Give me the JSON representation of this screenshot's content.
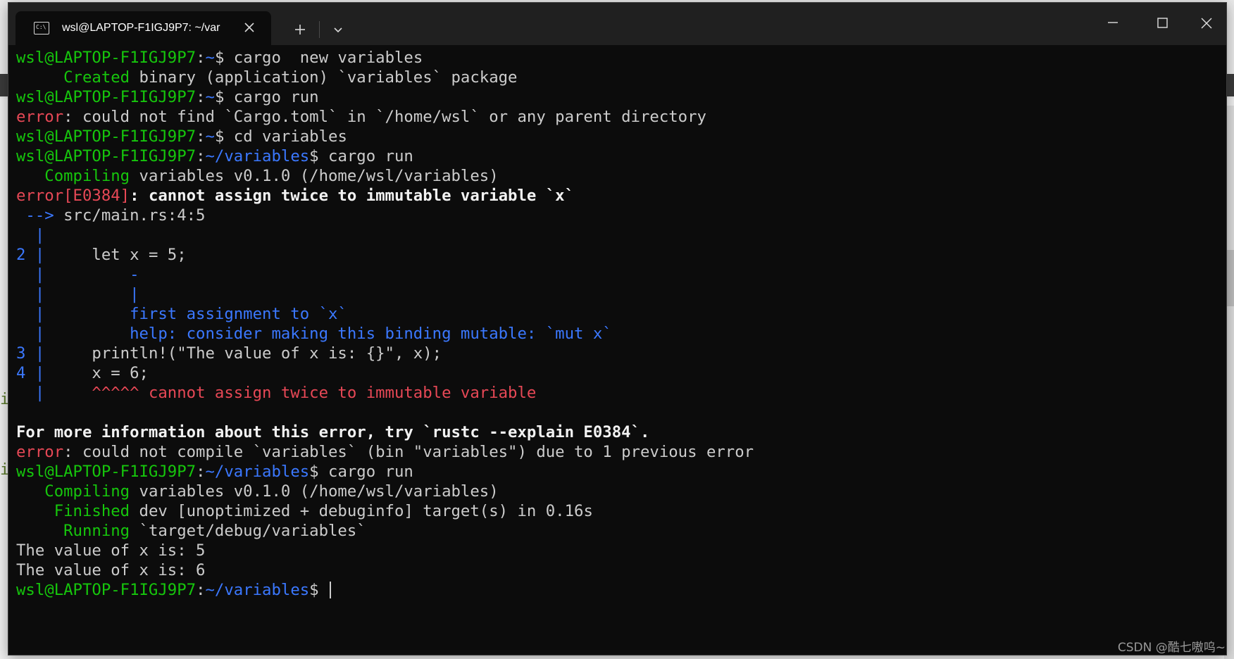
{
  "window": {
    "tab_title": "wsl@LAPTOP-F1IGJ9P7: ~/var"
  },
  "colors": {
    "prompt_user": "#16c60c",
    "prompt_path": "#3b78ff",
    "error": "#e74856",
    "text": "#cccccc",
    "background": "#0c0c0c"
  },
  "icons": {
    "tab": "terminal-icon",
    "close_tab": "close-icon",
    "new_tab": "plus-icon",
    "dropdown": "chevron-down-icon",
    "minimize": "minimize-icon",
    "maximize": "maximize-icon",
    "close_window": "close-icon"
  },
  "terminal": {
    "lines": [
      [
        {
          "t": "wsl@LAPTOP-F1IGJ9P7",
          "c": "green"
        },
        {
          "t": ":",
          "c": "plain"
        },
        {
          "t": "~",
          "c": "blue"
        },
        {
          "t": "$ cargo  new variables",
          "c": "plain"
        }
      ],
      [
        {
          "t": "     Created",
          "c": "green"
        },
        {
          "t": " binary (application) `variables` package",
          "c": "plain"
        }
      ],
      [
        {
          "t": "wsl@LAPTOP-F1IGJ9P7",
          "c": "green"
        },
        {
          "t": ":",
          "c": "plain"
        },
        {
          "t": "~",
          "c": "blue"
        },
        {
          "t": "$ cargo run",
          "c": "plain"
        }
      ],
      [
        {
          "t": "error",
          "c": "red"
        },
        {
          "t": ": could not find `Cargo.toml` in `/home/wsl` or any parent directory",
          "c": "plain"
        }
      ],
      [
        {
          "t": "wsl@LAPTOP-F1IGJ9P7",
          "c": "green"
        },
        {
          "t": ":",
          "c": "plain"
        },
        {
          "t": "~",
          "c": "blue"
        },
        {
          "t": "$ cd variables",
          "c": "plain"
        }
      ],
      [
        {
          "t": "wsl@LAPTOP-F1IGJ9P7",
          "c": "green"
        },
        {
          "t": ":",
          "c": "plain"
        },
        {
          "t": "~/variables",
          "c": "blue"
        },
        {
          "t": "$ cargo run",
          "c": "plain"
        }
      ],
      [
        {
          "t": "   Compiling",
          "c": "green"
        },
        {
          "t": " variables v0.1.0 (/home/wsl/variables)",
          "c": "plain"
        }
      ],
      [
        {
          "t": "error[E0384]",
          "c": "red"
        },
        {
          "t": ": cannot assign twice to immutable variable `x`",
          "c": "white"
        }
      ],
      [
        {
          "t": " -->",
          "c": "blue"
        },
        {
          "t": " src/main.rs:4:5",
          "c": "plain"
        }
      ],
      [
        {
          "t": "  |",
          "c": "blue"
        }
      ],
      [
        {
          "t": "2 |",
          "c": "blue"
        },
        {
          "t": "     let x = 5;",
          "c": "plain"
        }
      ],
      [
        {
          "t": "  |         -",
          "c": "blue"
        }
      ],
      [
        {
          "t": "  |         |",
          "c": "blue"
        }
      ],
      [
        {
          "t": "  |         first assignment to `x`",
          "c": "blue"
        }
      ],
      [
        {
          "t": "  |         help: consider making this binding mutable: `mut x`",
          "c": "blue"
        }
      ],
      [
        {
          "t": "3 |",
          "c": "blue"
        },
        {
          "t": "     println!(\"The value of x is: {}\", x);",
          "c": "plain"
        }
      ],
      [
        {
          "t": "4 |",
          "c": "blue"
        },
        {
          "t": "     x = 6;",
          "c": "plain"
        }
      ],
      [
        {
          "t": "  |",
          "c": "blue"
        },
        {
          "t": "     ^^^^^ cannot assign twice to immutable variable",
          "c": "red"
        }
      ],
      [
        {
          "t": "",
          "c": "plain"
        }
      ],
      [
        {
          "t": "For more information about this error, try `rustc --explain E0384`.",
          "c": "white"
        }
      ],
      [
        {
          "t": "error",
          "c": "red"
        },
        {
          "t": ": could not compile `variables` (bin \"variables\") due to 1 previous error",
          "c": "plain"
        }
      ],
      [
        {
          "t": "wsl@LAPTOP-F1IGJ9P7",
          "c": "green"
        },
        {
          "t": ":",
          "c": "plain"
        },
        {
          "t": "~/variables",
          "c": "blue"
        },
        {
          "t": "$ cargo run",
          "c": "plain"
        }
      ],
      [
        {
          "t": "   Compiling",
          "c": "green"
        },
        {
          "t": " variables v0.1.0 (/home/wsl/variables)",
          "c": "plain"
        }
      ],
      [
        {
          "t": "    Finished",
          "c": "green"
        },
        {
          "t": " dev [unoptimized + debuginfo] target(s) in 0.16s",
          "c": "plain"
        }
      ],
      [
        {
          "t": "     Running",
          "c": "green"
        },
        {
          "t": " `target/debug/variables`",
          "c": "plain"
        }
      ],
      [
        {
          "t": "The value of x is: 5",
          "c": "plain"
        }
      ],
      [
        {
          "t": "The value of x is: 6",
          "c": "plain"
        }
      ],
      [
        {
          "t": "wsl@LAPTOP-F1IGJ9P7",
          "c": "green"
        },
        {
          "t": ":",
          "c": "plain"
        },
        {
          "t": "~/variables",
          "c": "blue"
        },
        {
          "t": "$ ",
          "c": "plain"
        }
      ]
    ]
  },
  "background": {
    "left_glyphs": [
      "i",
      "i"
    ]
  },
  "watermark": "CSDN @酷七嗷呜~"
}
